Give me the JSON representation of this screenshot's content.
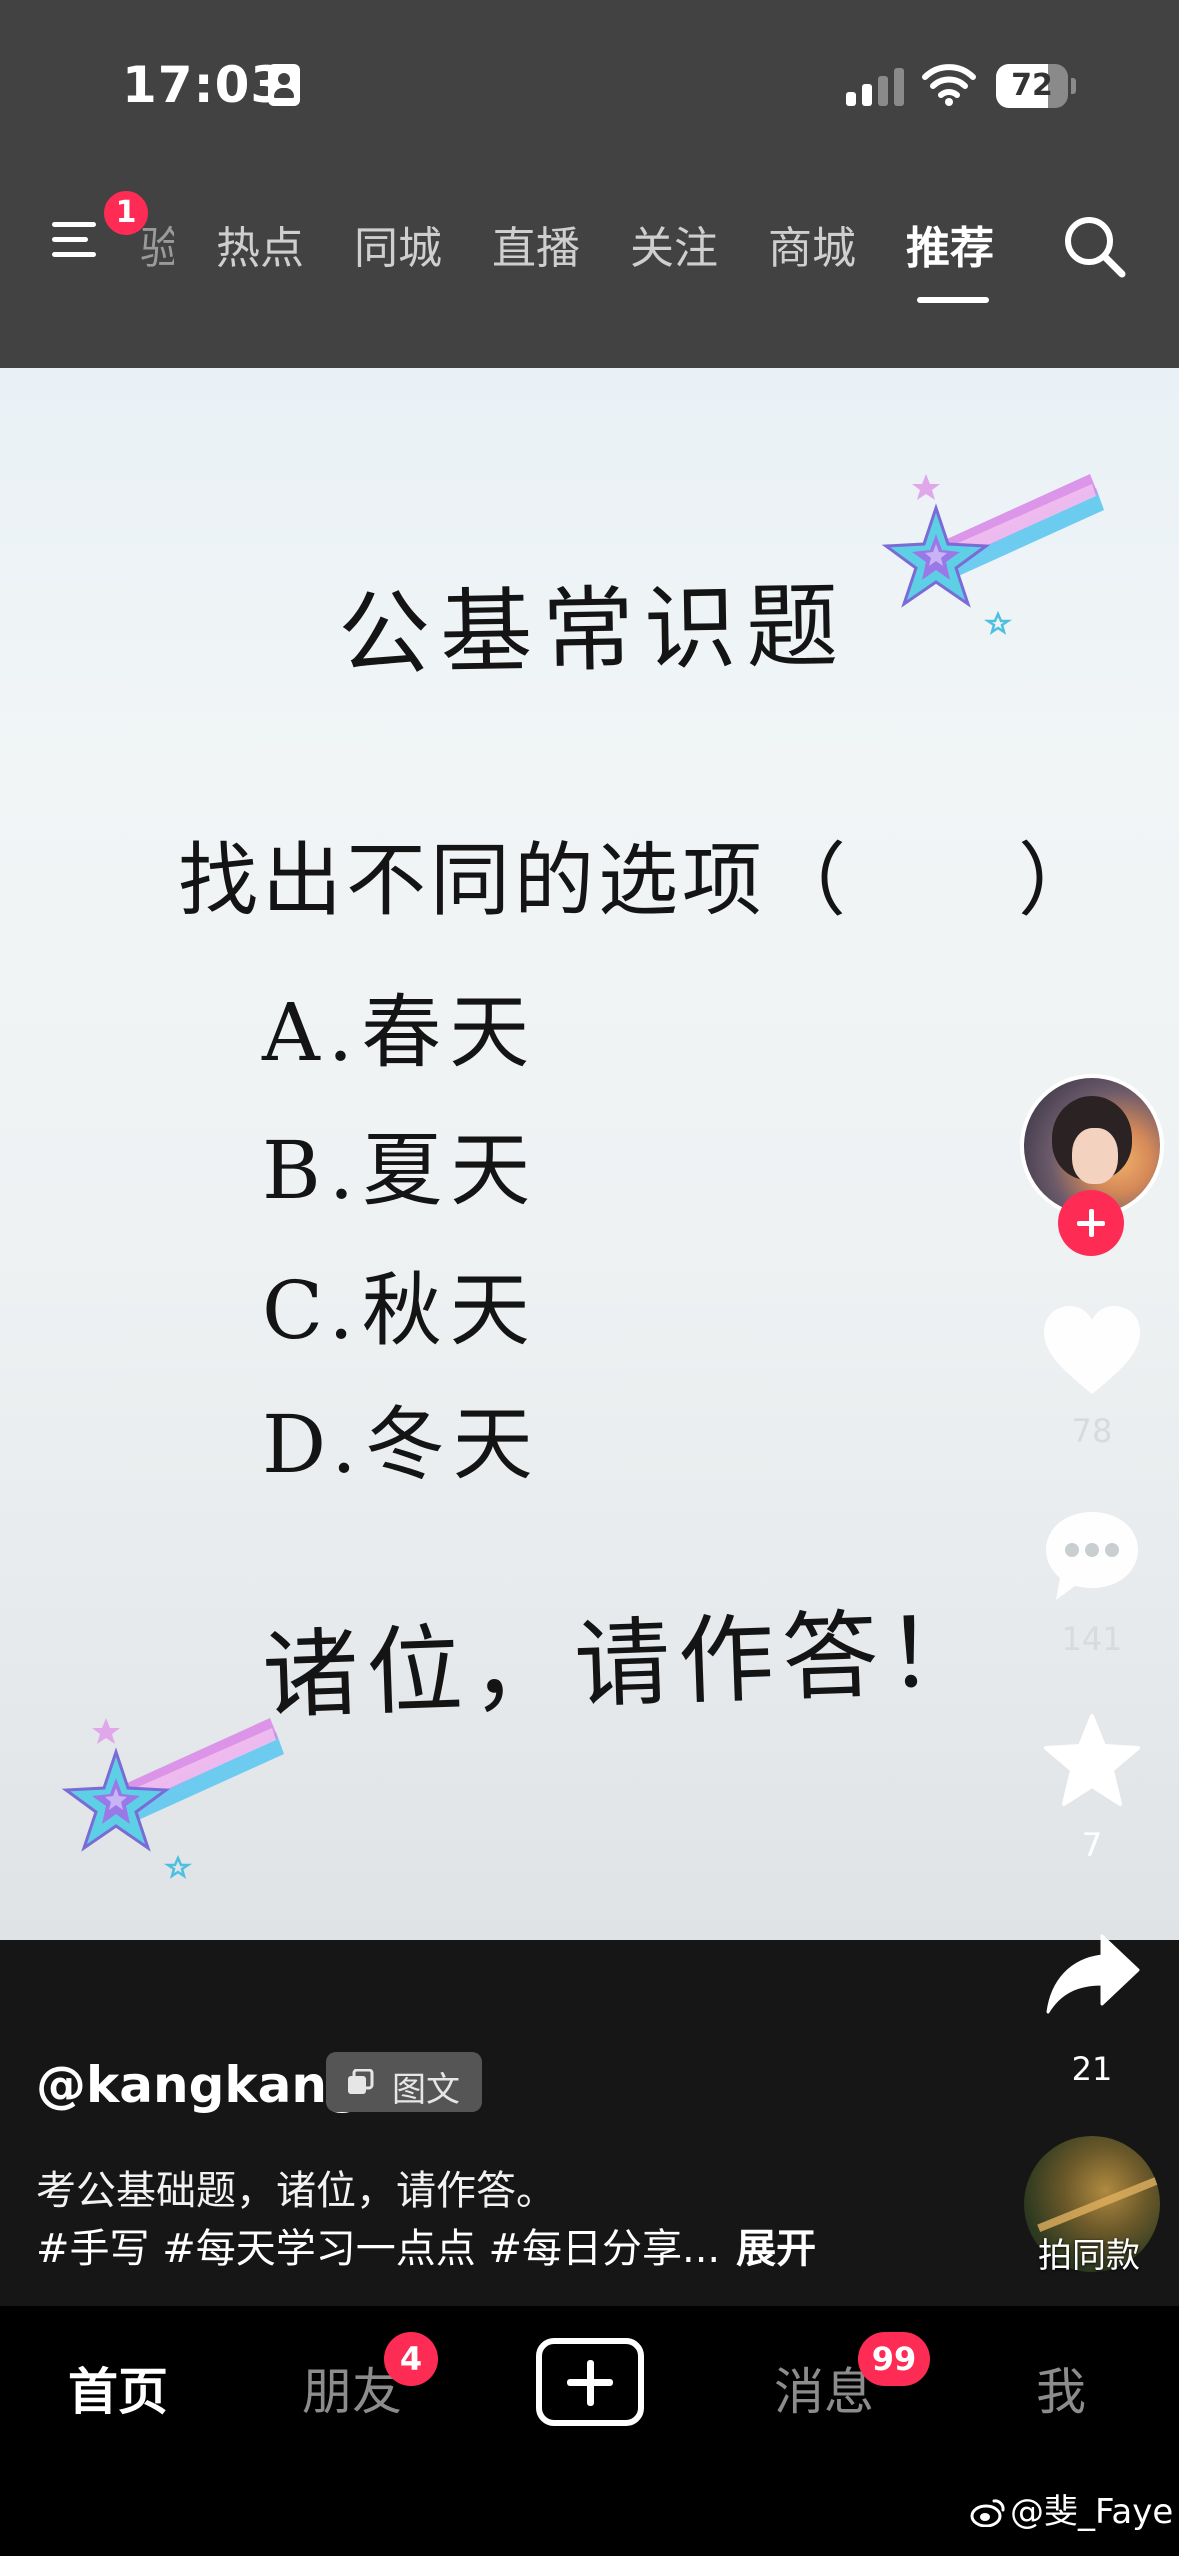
{
  "status_bar": {
    "time": "17:03",
    "battery": "72",
    "battery_level": 0.72,
    "icons": [
      "id-card-icon",
      "signal-icon",
      "wifi-icon",
      "battery-icon"
    ]
  },
  "top_nav": {
    "menu_badge": "1",
    "tabs": [
      {
        "label": "验",
        "partial": true
      },
      {
        "label": "热点"
      },
      {
        "label": "同城"
      },
      {
        "label": "直播"
      },
      {
        "label": "关注"
      },
      {
        "label": "商城"
      },
      {
        "label": "推荐",
        "active": true
      }
    ],
    "icons": [
      "menu-icon",
      "search-icon"
    ]
  },
  "post_image": {
    "title": "公基常识题",
    "question": "找出不同的选项（　　）",
    "options": [
      "A.春天",
      "B.夏天",
      "C.秋天",
      "D.冬天"
    ],
    "closing": "诸位，请作答！",
    "decorations": [
      "shooting-star-icon",
      "shooting-star-icon"
    ]
  },
  "actions": {
    "likes": "78",
    "comments": "141",
    "favorites": "7",
    "shares": "21",
    "music_label": "拍同款",
    "icons": [
      "heart-icon",
      "comment-icon",
      "star-icon",
      "share-icon",
      "plus-icon"
    ]
  },
  "post": {
    "username": "@kangkang",
    "type_tag": "图文",
    "caption": "考公基础题，诸位，请作答。",
    "hashtags": "#手写 #每天学习一点点 #每日分享...",
    "expand": "展开"
  },
  "tab_bar": {
    "home": "首页",
    "friends": "朋友",
    "friends_badge": "4",
    "messages": "消息",
    "messages_badge": "99",
    "me": "我"
  },
  "watermark": "@斐_Faye",
  "colors": {
    "accent": "#fe2c55",
    "top_bar": "#424242",
    "tab_bar": "#000000",
    "caption_bg": "#161616"
  }
}
